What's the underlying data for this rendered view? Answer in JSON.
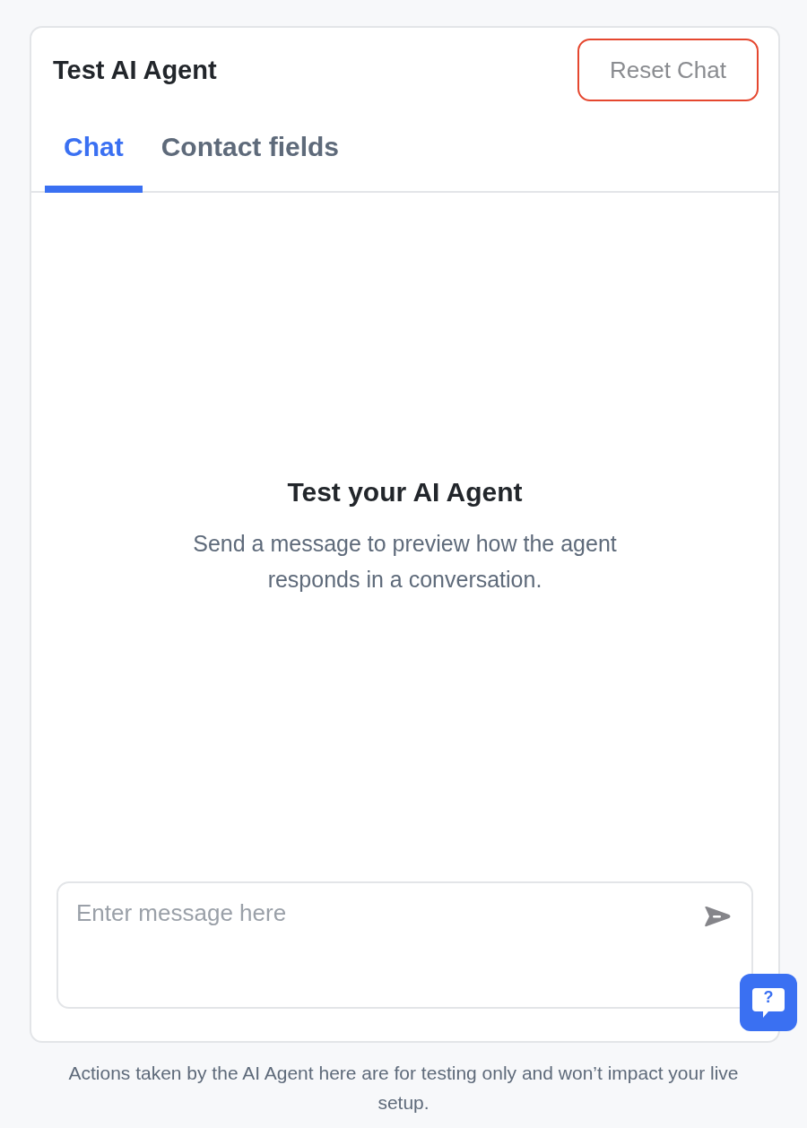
{
  "panel": {
    "title": "Test AI Agent",
    "reset_button": "Reset Chat"
  },
  "tabs": [
    {
      "label": "Chat",
      "selected": true
    },
    {
      "label": "Contact fields",
      "selected": false
    }
  ],
  "empty_state": {
    "title": "Test your AI Agent",
    "description": "Send a message to preview how the agent responds in a conversation."
  },
  "composer": {
    "placeholder": "Enter message here"
  },
  "help_button": {
    "label": "?"
  },
  "footer_note": "Actions taken by the AI Agent here are for testing only and won’t impact your live setup."
}
